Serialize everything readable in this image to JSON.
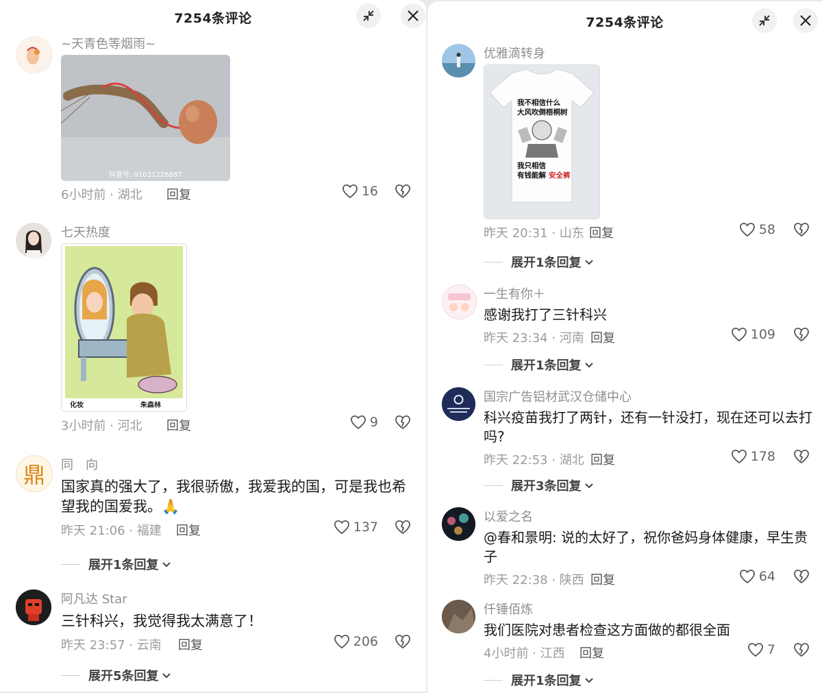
{
  "left": {
    "title": "7254条评论",
    "comments": [
      {
        "username": "~天青色等烟雨~",
        "image_watermark": "抖音号: 91031226887",
        "time": "6小时前 · 湖北",
        "reply": "回复",
        "likes": "16"
      },
      {
        "username": "七天热度",
        "image_caption_left": "化妆",
        "image_caption_right": "朱森林",
        "time": "3小时前 · 河北",
        "reply": "回复",
        "likes": "9"
      },
      {
        "username": "同　向",
        "avatar_char": "鼎",
        "text": "国家真的强大了，我很骄傲，我爱我的国，可是我也希望我的国爱我。🙏",
        "time": "昨天 21:06 · 福建",
        "reply": "回复",
        "likes": "137",
        "expand": "展开1条回复"
      },
      {
        "username": "阿凡达 Star",
        "text": "三针科兴，我觉得我太满意了！",
        "time": "昨天 23:57 · 云南",
        "reply": "回复",
        "likes": "206",
        "expand": "展开5条回复"
      }
    ]
  },
  "right": {
    "title": "7254条评论",
    "comments": [
      {
        "username": "优雅滴转身",
        "shirt_line1": "我不相信什么",
        "shirt_line2": "大风吹倒梧桐树",
        "shirt_line3": "我只相信",
        "shirt_line4a": "有钱能解",
        "shirt_line4b": "安全裤",
        "time": "昨天 20:31 · 山东",
        "reply": "回复",
        "likes": "58",
        "expand": "展开1条回复"
      },
      {
        "username": "一生有你＋",
        "text": "感谢我打了三针科兴",
        "time": "昨天 23:34 · 河南",
        "reply": "回复",
        "likes": "109",
        "expand": "展开1条回复"
      },
      {
        "username": "国宗广告铝材武汉仓储中心",
        "text": "科兴疫苗我打了两针，还有一针没打，现在还可以去打吗?",
        "time": "昨天 22:53 · 湖北",
        "reply": "回复",
        "likes": "178",
        "expand": "展开3条回复"
      },
      {
        "username": "以爱之名",
        "text": "@春和景明: 说的太好了，祝你爸妈身体健康，早生贵子",
        "time": "昨天 22:38 · 陕西",
        "reply": "回复",
        "likes": "64"
      },
      {
        "username": "仟锤佰炼",
        "text": "我们医院对患者检查这方面做的都很全面",
        "time": "4小时前 · 江西",
        "reply": "回复",
        "likes": "7",
        "expand": "展开1条回复"
      }
    ]
  },
  "icons": {
    "collapse": "collapse-icon",
    "close": "close-icon",
    "like": "heart-icon",
    "dislike": "broken-heart-icon",
    "expand": "chevron-down-icon"
  }
}
